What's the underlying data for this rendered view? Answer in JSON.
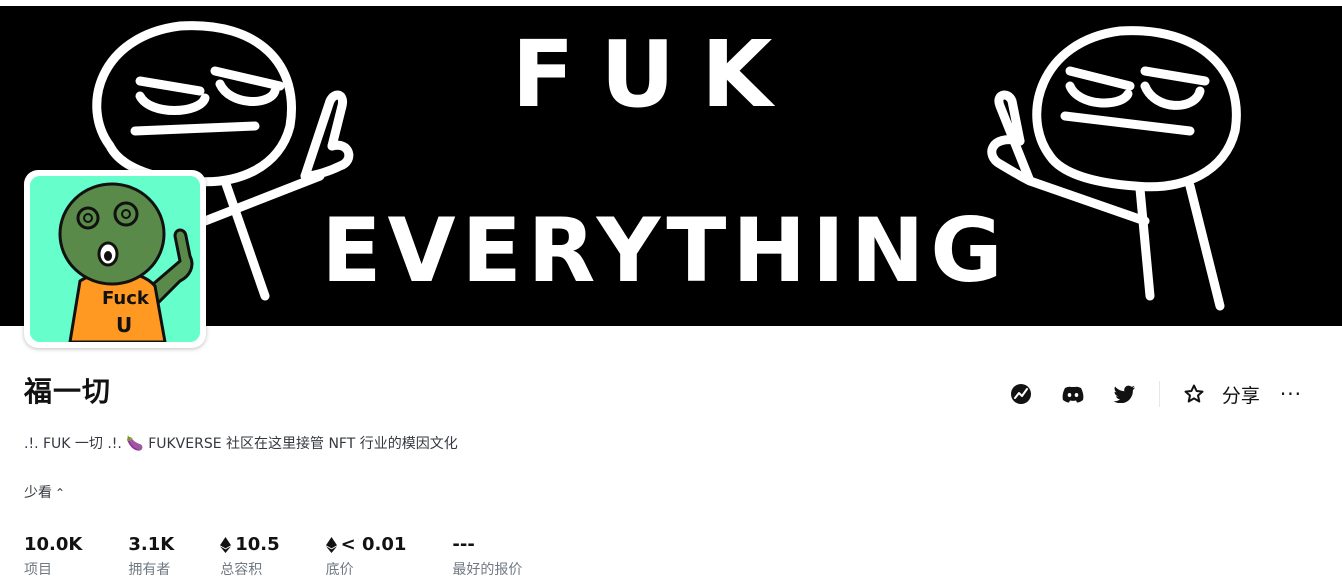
{
  "banner": {
    "line1": "FUK",
    "line2": "EVERYTHING"
  },
  "avatar": {
    "shirt_text_1": "Fuck",
    "shirt_text_2": "U",
    "background": "#66ffcc",
    "shirt_color": "#ff9922",
    "head_color": "#5a8a4a"
  },
  "collection": {
    "title": "福一切",
    "description": ".!. FUK 一切 .!. 🍆 FUKVERSE 社区在这里接管 NFT 行业的模因文化",
    "toggle_label": "少看",
    "toggle_icon": "chevron-up-icon"
  },
  "actions": {
    "icons": [
      "chart-icon",
      "discord-icon",
      "twitter-icon",
      "star-icon"
    ],
    "share_label": "分享",
    "more_label": "···"
  },
  "stats": [
    {
      "value": "10.0K",
      "label": "项目",
      "eth": false
    },
    {
      "value": "3.1K",
      "label": "拥有者",
      "eth": false
    },
    {
      "value": "10.5",
      "label": "总容积",
      "eth": true
    },
    {
      "value": "< 0.01",
      "label": "底价",
      "eth": true
    },
    {
      "value": "---",
      "label": "最好的报价",
      "eth": false
    }
  ]
}
